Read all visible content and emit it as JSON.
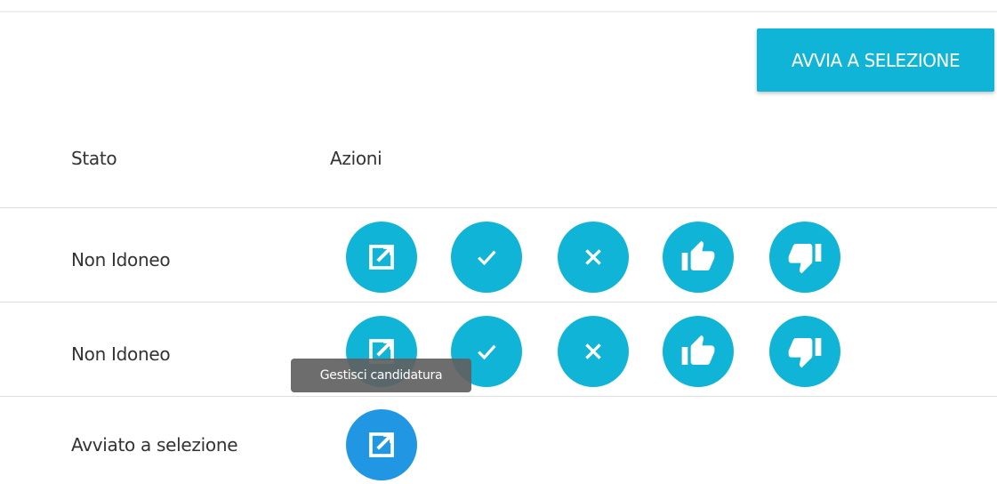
{
  "toolbar": {
    "start_selection_label": "AVVIA A SELEZIONE"
  },
  "table": {
    "headers": {
      "stato": "Stato",
      "azioni": "Azioni"
    },
    "rows": [
      {
        "stato": "Non Idoneo",
        "actions": [
          "manage-icon",
          "check-icon",
          "close-icon",
          "thumb-up-icon",
          "thumb-down-icon"
        ]
      },
      {
        "stato": "Non Idoneo",
        "actions": [
          "manage-icon",
          "check-icon",
          "close-icon",
          "thumb-up-icon",
          "thumb-down-icon"
        ]
      },
      {
        "stato": "Avviato a selezione",
        "actions": [
          "manage-icon"
        ]
      }
    ]
  },
  "tooltip": {
    "text": "Gestisci candidatura"
  },
  "colors": {
    "accent": "#10b4d6",
    "accent_active": "#2196e3",
    "tooltip_bg": "#616161"
  }
}
